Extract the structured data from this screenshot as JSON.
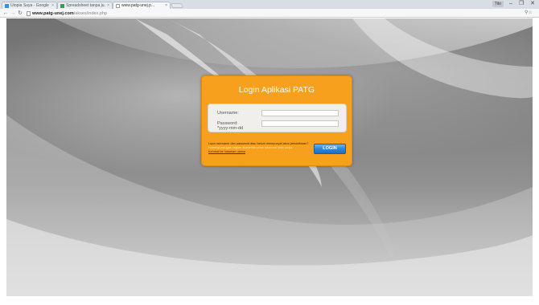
{
  "browser": {
    "tabs": [
      {
        "label": "Utopia Saya - Google",
        "active": false,
        "favicon": "drive-icon",
        "favicon_color": "#3c8fdc"
      },
      {
        "label": "Spreadsheet tanpa ju...",
        "active": false,
        "favicon": "sheets-icon",
        "favicon_color": "#22a65a"
      },
      {
        "label": "www.patg-unej.p...",
        "active": true,
        "favicon": "page-icon",
        "favicon_color": "#ffffff"
      }
    ],
    "url_host": "www.patg-unej.com",
    "url_path": "/akses/index.php",
    "user_button": "Tito"
  },
  "login": {
    "title": "Login Aplikasi PATG",
    "username_label": "Username:",
    "password_label_line1": "Password:",
    "password_label_line2": "*yyyy-mm-dd",
    "username_value": "",
    "password_value": "",
    "help_question": "Lupa username dan password atau belum mempunyai akun pendaftaran?",
    "help_info": "Hubungi petugas bagian akademik untuk informasi lebih lanjut",
    "help_link": "Kembali ke halaman utama",
    "button_label": "LOGIN"
  },
  "colors": {
    "panel": "#f7a01d",
    "button": "#2d86d6",
    "background": "#8a8a8a"
  }
}
